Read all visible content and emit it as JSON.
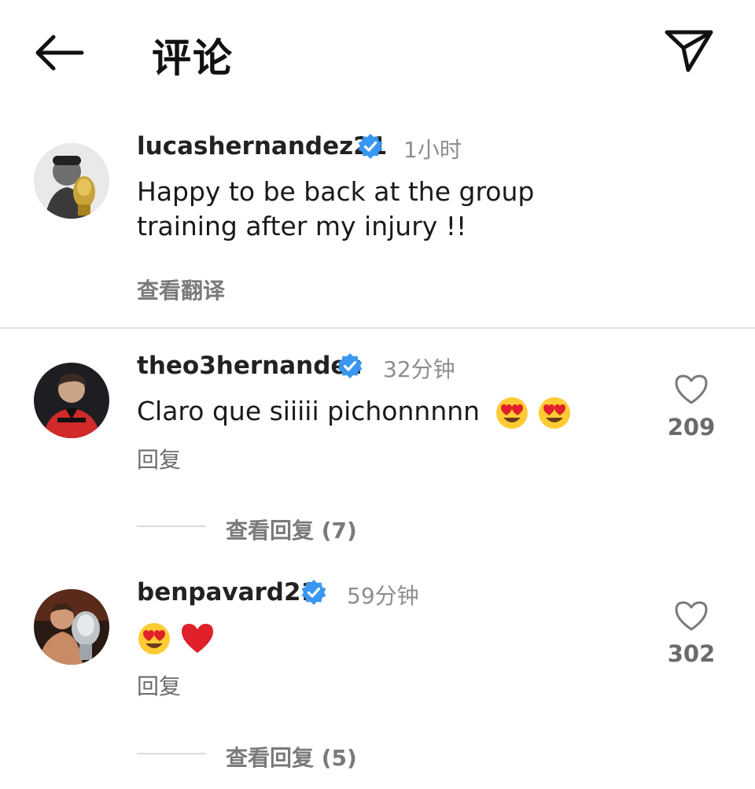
{
  "header": {
    "title": "评论",
    "back_icon": "arrow-left-icon",
    "send_icon": "paper-plane-icon"
  },
  "caption": {
    "username": "lucashernandez21",
    "verified": true,
    "time": "1小时",
    "text_line1": "Happy to be back at the group",
    "text_line2": "training after my injury !!",
    "translate_label": "查看翻译"
  },
  "comments": [
    {
      "username": "theo3hernandez",
      "verified": true,
      "time": "32分钟",
      "text": "Claro que siiiii pichonnnnn",
      "emojis": [
        "heart-eyes-emoji",
        "heart-eyes-emoji"
      ],
      "reply_label": "回复",
      "view_replies": "查看回复 (7)",
      "likes": "209"
    },
    {
      "username": "benpavard21",
      "verified": true,
      "time": "59分钟",
      "text": "",
      "emojis": [
        "heart-eyes-emoji",
        "red-heart-emoji"
      ],
      "reply_label": "回复",
      "view_replies": "查看回复 (5)",
      "likes": "302"
    }
  ],
  "colors": {
    "verified_blue": "#3897f0",
    "secondary_text": "#8e8e8e",
    "heart_red": "#e0202a",
    "emoji_yellow": "#ffcc33"
  }
}
